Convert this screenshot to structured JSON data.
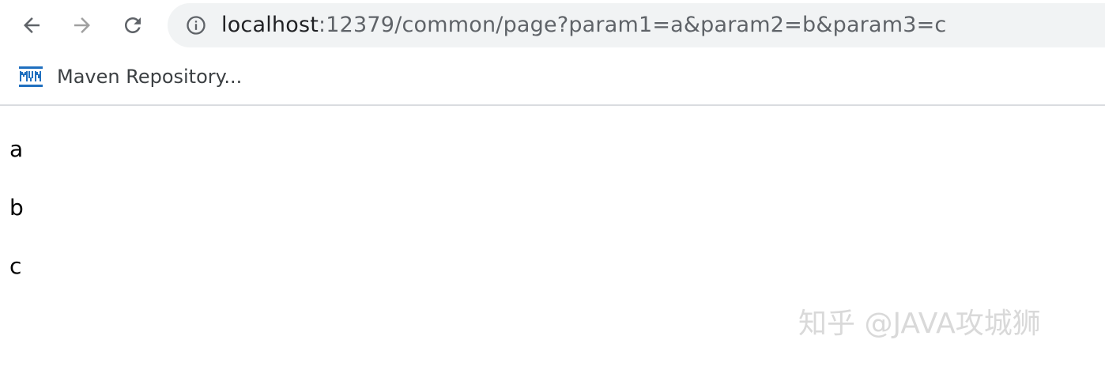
{
  "toolbar": {
    "back_icon": "back-arrow-icon",
    "forward_icon": "forward-arrow-icon",
    "reload_icon": "reload-icon",
    "address": {
      "info_icon": "info-icon",
      "host": "localhost",
      "rest": ":12379/common/page?param1=a&param2=b&param3=c"
    }
  },
  "bookmarks": {
    "items": [
      {
        "icon": "maven-icon",
        "label": "Maven Repository..."
      }
    ]
  },
  "page": {
    "lines": [
      "a",
      "b",
      "c"
    ]
  },
  "watermark": {
    "text": "知乎 @JAVA攻城狮"
  },
  "colors": {
    "omnibox_bg": "#f1f3f4",
    "maven_blue": "#1f6fbf",
    "icon_gray": "#5f6368",
    "disabled_gray": "#a0a0a0"
  }
}
